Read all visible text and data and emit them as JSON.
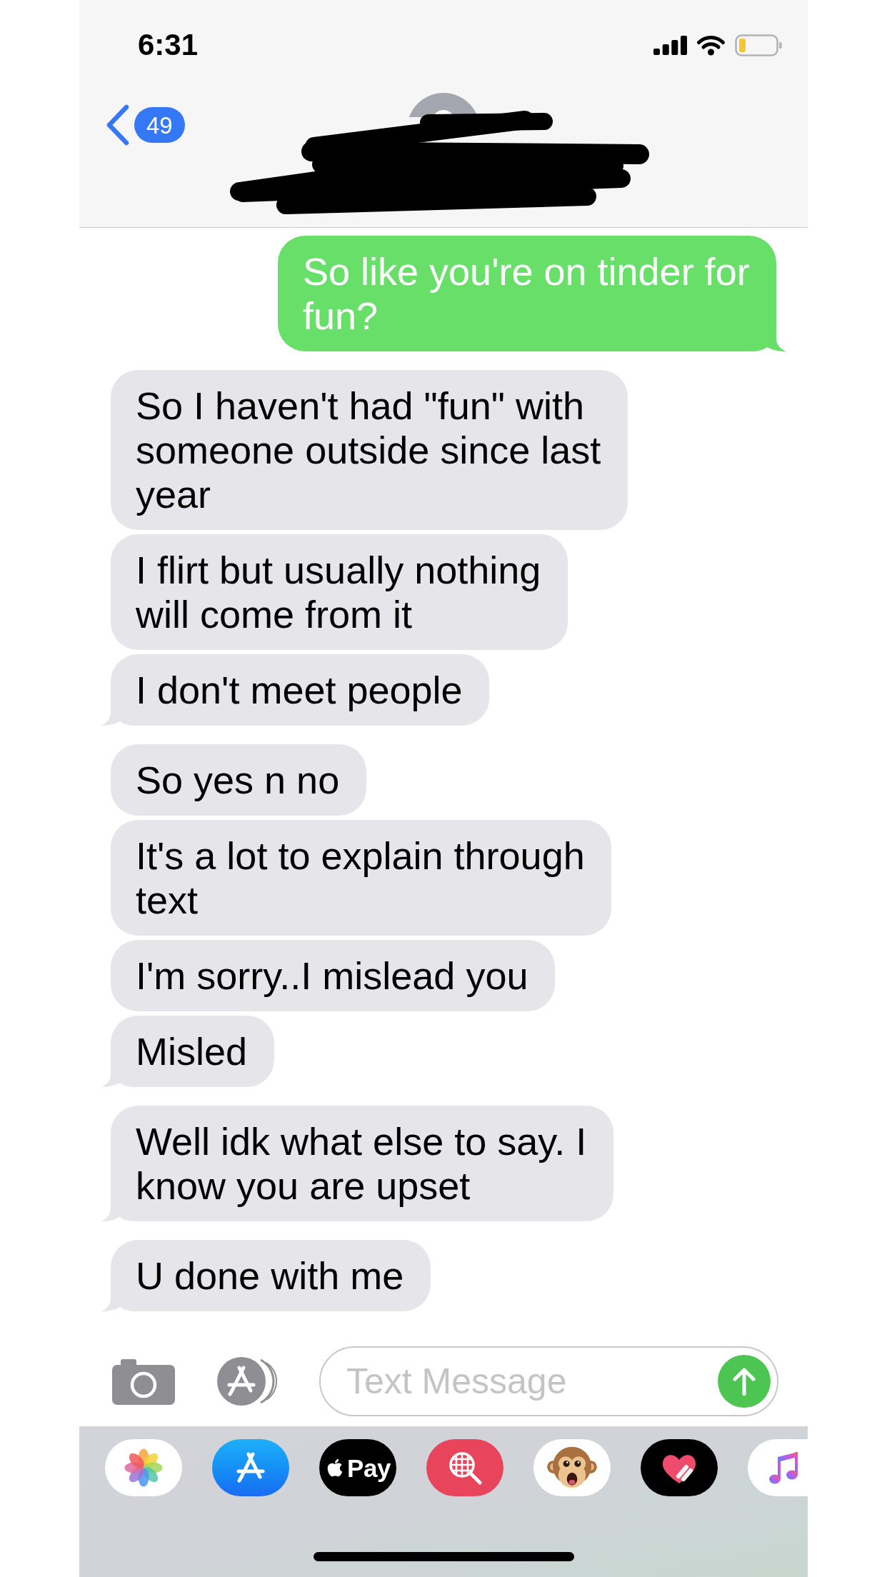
{
  "status_bar": {
    "time": "6:31"
  },
  "header": {
    "back_badge": "49"
  },
  "messages": [
    {
      "kind": "sent",
      "text": "So like you're on tinder for fun?",
      "tail": true
    },
    {
      "kind": "received",
      "text": "So I haven't had \"fun\" with someone outside since last year",
      "tail": false
    },
    {
      "kind": "received",
      "text": "I flirt but usually nothing will come from it",
      "tail": false
    },
    {
      "kind": "received",
      "text": "I don't meet people",
      "tail": true
    },
    {
      "kind": "received",
      "text": "So yes n no",
      "tail": false
    },
    {
      "kind": "received",
      "text": "It's a lot to explain through text",
      "tail": false
    },
    {
      "kind": "received",
      "text": "I'm sorry..I mislead you",
      "tail": false
    },
    {
      "kind": "received",
      "text": "Misled",
      "tail": true
    },
    {
      "kind": "received",
      "text": "Well idk what else to say. I know you are upset",
      "tail": true
    },
    {
      "kind": "received",
      "text": "U done with me",
      "tail": true
    }
  ],
  "composer": {
    "placeholder": "Text Message"
  },
  "app_drawer": {
    "apps": [
      {
        "kind": "photos"
      },
      {
        "kind": "app_store"
      },
      {
        "kind": "apple_pay",
        "label": "Pay"
      },
      {
        "kind": "image_search"
      },
      {
        "kind": "animoji"
      },
      {
        "kind": "digital_touch"
      },
      {
        "kind": "music"
      }
    ]
  }
}
